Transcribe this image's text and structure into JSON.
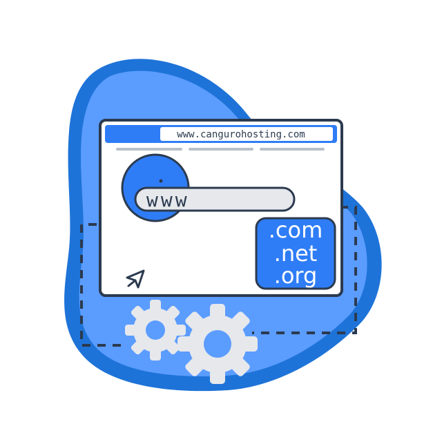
{
  "browser": {
    "address_bar": {
      "url": "www.cangurohosting.com"
    }
  },
  "search_bar": {
    "text": "www"
  },
  "domain_card": {
    "tlds": [
      ".com",
      ".net",
      ".org"
    ]
  },
  "icons": [
    "cursor-arrow-icon",
    "gear-icon",
    "gear-icon"
  ],
  "colors": {
    "blob_dark": "#1e73d8",
    "blob_light": "#5b9cff",
    "accent_blue": "#2f7df6",
    "outline": "#2b3a4f",
    "window_bg": "#ffffff",
    "gray": "#e6e8ec",
    "tab_line": "#b8c0ca"
  }
}
